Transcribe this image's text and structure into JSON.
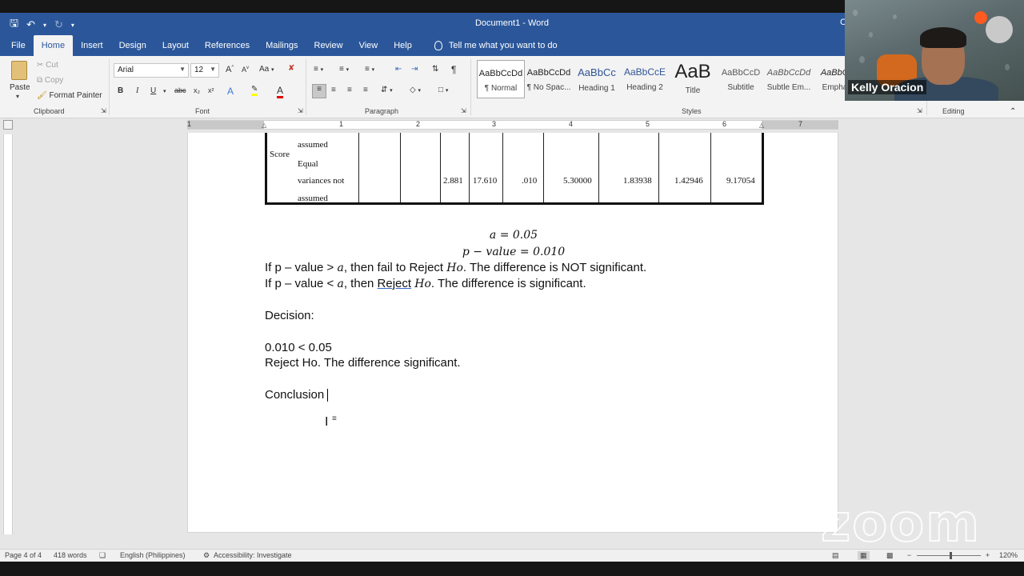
{
  "window": {
    "title": "Document1 - Word",
    "right_label": "C"
  },
  "tabs": [
    "File",
    "Home",
    "Insert",
    "Design",
    "Layout",
    "References",
    "Mailings",
    "Review",
    "View",
    "Help"
  ],
  "tell_me": "Tell me what you want to do",
  "clipboard": {
    "paste": "Paste",
    "cut": "Cut",
    "copy": "Copy",
    "format_painter": "Format Painter",
    "group": "Clipboard"
  },
  "font": {
    "name": "Arial",
    "size": "12",
    "group": "Font",
    "bold": "B",
    "italic": "I",
    "underline": "U",
    "strike": "abc",
    "subscript": "x₂",
    "superscript": "x²",
    "grow": "A",
    "shrink": "A",
    "case": "Aa"
  },
  "paragraph": {
    "group": "Paragraph",
    "pilcrow": "¶"
  },
  "styles": {
    "group": "Styles",
    "items": [
      {
        "preview": "AaBbCcDd",
        "name": "¶ Normal"
      },
      {
        "preview": "AaBbCcDd",
        "name": "¶ No Spac..."
      },
      {
        "preview": "AaBbCc",
        "name": "Heading 1"
      },
      {
        "preview": "AaBbCcE",
        "name": "Heading 2"
      },
      {
        "preview": "AaB",
        "name": "Title"
      },
      {
        "preview": "AaBbCcD",
        "name": "Subtitle"
      },
      {
        "preview": "AaBbCcDd",
        "name": "Subtle Em..."
      },
      {
        "preview": "AaBbCc",
        "name": "Emphas"
      }
    ]
  },
  "editing": {
    "group": "Editing"
  },
  "webcam": {
    "participant_name": "Kelly Oracion"
  },
  "ruler_numbers": [
    "1",
    "1",
    "2",
    "3",
    "4",
    "5",
    "6",
    "7"
  ],
  "table": {
    "row_label": "Score",
    "rows_text": [
      "assumed",
      "Equal",
      "variances not",
      "assumed"
    ],
    "values": [
      "2.881",
      "17.610",
      ".010",
      "5.30000",
      "1.83938",
      "1.42946",
      "9.17054"
    ]
  },
  "document": {
    "alpha_eq": "a = 0.05",
    "pvalue_eq": "p − value = 0.010",
    "rule1_pre": "If p – value > ",
    "rule1_a": "a",
    "rule1_mid": ", then fail to Reject ",
    "rule1_ho": "Ho",
    "rule1_post": ". The difference is NOT significant.",
    "rule2_pre": "If p – value < ",
    "rule2_a": "a",
    "rule2_mid": ", then ",
    "rule2_reject": "Reject",
    "rule2_ho": "Ho",
    "rule2_post": ". The difference is significant.",
    "decision": "Decision:",
    "comparison": "0.010 < 0.05",
    "reject_line": "Reject Ho. The difference significant.",
    "conclusion": "Conclusion"
  },
  "watermark": "zoom",
  "status": {
    "page": "Page 4 of 4",
    "words": "418 words",
    "language": "English (Philippines)",
    "accessibility": "Accessibility: Investigate",
    "zoom": "120%",
    "zoom_minus": "−",
    "zoom_plus": "+"
  }
}
